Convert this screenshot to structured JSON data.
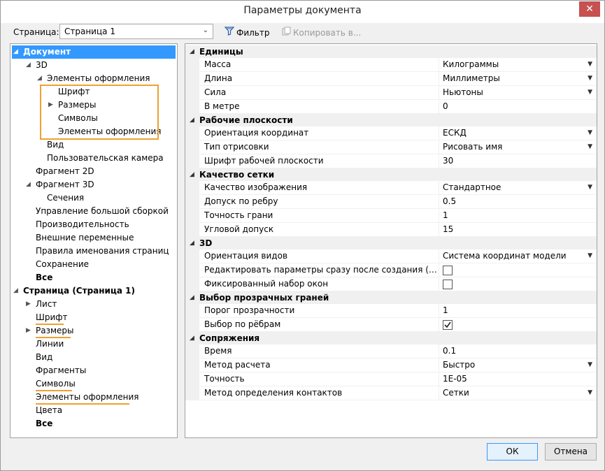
{
  "window": {
    "title": "Параметры документа",
    "close_glyph": "✕"
  },
  "toolbar": {
    "page_label": "Страница:",
    "page_value": "Страница 1",
    "filter_label": "Фильтр",
    "copy_label": "Копировать в..."
  },
  "tree": [
    {
      "label": "Документ",
      "level": 0,
      "expanded": true,
      "selected": true,
      "bold": true
    },
    {
      "label": "3D",
      "level": 1,
      "expanded": true
    },
    {
      "label": "Элементы оформления",
      "level": 2,
      "expanded": true
    },
    {
      "label": "Шрифт",
      "level": 3
    },
    {
      "label": "Размеры",
      "level": 3,
      "collapsed": true
    },
    {
      "label": "Символы",
      "level": 3
    },
    {
      "label": "Элементы оформления",
      "level": 3
    },
    {
      "label": "Вид",
      "level": 2
    },
    {
      "label": "Пользовательская камера",
      "level": 2
    },
    {
      "label": "Фрагмент 2D",
      "level": 1
    },
    {
      "label": "Фрагмент 3D",
      "level": 1,
      "expanded": true
    },
    {
      "label": "Сечения",
      "level": 2
    },
    {
      "label": "Управление большой сборкой",
      "level": 1
    },
    {
      "label": "Производительность",
      "level": 1
    },
    {
      "label": "Внешние переменные",
      "level": 1
    },
    {
      "label": "Правила именования страниц",
      "level": 1
    },
    {
      "label": "Сохранение",
      "level": 1
    },
    {
      "label": "Все",
      "level": 1,
      "bold": true
    },
    {
      "label": "Страница (Страница 1)",
      "level": 0,
      "expanded": true,
      "bold": true
    },
    {
      "label": "Лист",
      "level": 1,
      "collapsed": true
    },
    {
      "label": "Шрифт",
      "level": 1
    },
    {
      "label": "Размеры",
      "level": 1,
      "collapsed": true
    },
    {
      "label": "Линии",
      "level": 1
    },
    {
      "label": "Вид",
      "level": 1
    },
    {
      "label": "Фрагменты",
      "level": 1
    },
    {
      "label": "Символы",
      "level": 1
    },
    {
      "label": "Элементы оформления",
      "level": 1
    },
    {
      "label": "Цвета",
      "level": 1
    },
    {
      "label": "Все",
      "level": 1,
      "bold": true
    }
  ],
  "properties": [
    {
      "group": "Единицы",
      "rows": [
        {
          "name": "Масса",
          "value": "Килограммы",
          "dropdown": true
        },
        {
          "name": "Длина",
          "value": "Миллиметры",
          "dropdown": true
        },
        {
          "name": "Сила",
          "value": "Ньютоны",
          "dropdown": true
        },
        {
          "name": "В метре",
          "value": "0"
        }
      ]
    },
    {
      "group": "Рабочие плоскости",
      "rows": [
        {
          "name": "Ориентация координат",
          "value": "ЕСКД",
          "dropdown": true
        },
        {
          "name": "Тип отрисовки",
          "value": "Рисовать имя",
          "dropdown": true
        },
        {
          "name": "Шрифт рабочей плоскости",
          "value": "30"
        }
      ]
    },
    {
      "group": "Качество сетки",
      "rows": [
        {
          "name": "Качество изображения",
          "value": "Стандартное",
          "dropdown": true
        },
        {
          "name": "Допуск по ребру",
          "value": "0.5"
        },
        {
          "name": "Точность грани",
          "value": "1"
        },
        {
          "name": "Угловой допуск",
          "value": "15"
        }
      ]
    },
    {
      "group": "3D",
      "rows": [
        {
          "name": "Ориентация видов",
          "value": "Система координат модели",
          "dropdown": true
        },
        {
          "name": "Редактировать параметры сразу после создания (только д...",
          "checkbox": true,
          "checked": false
        },
        {
          "name": "Фиксированный набор окон",
          "checkbox": true,
          "checked": false
        }
      ]
    },
    {
      "group": "Выбор прозрачных граней",
      "rows": [
        {
          "name": "Порог прозрачности",
          "value": "1"
        },
        {
          "name": "Выбор по рёбрам",
          "checkbox": true,
          "checked": true
        }
      ]
    },
    {
      "group": "Сопряжения",
      "rows": [
        {
          "name": "Время",
          "value": "0.1"
        },
        {
          "name": "Метод расчета",
          "value": "Быстро",
          "dropdown": true
        },
        {
          "name": "Точность",
          "value": "1E-05"
        },
        {
          "name": "Метод определения контактов",
          "value": "Сетки",
          "dropdown": true
        }
      ]
    }
  ],
  "buttons": {
    "ok": "ОК",
    "cancel": "Отмена"
  },
  "colors": {
    "selection": "#3399ff",
    "annotation": "#f0a030"
  }
}
